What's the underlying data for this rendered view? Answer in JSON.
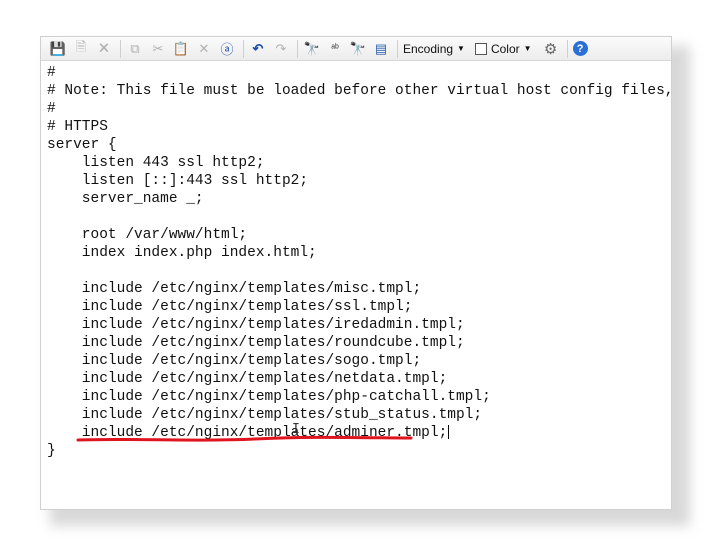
{
  "toolbar": {
    "icons": [
      {
        "name": "save-icon",
        "glyph": "💾",
        "disabled": true
      },
      {
        "name": "save-all-icon",
        "glyph": "🗎",
        "disabled": true
      },
      {
        "name": "close-file-icon",
        "glyph": "🗙",
        "disabled": true
      },
      {
        "name": "copy-icon",
        "glyph": "⧉",
        "disabled": true
      },
      {
        "name": "cut-icon",
        "glyph": "✂",
        "disabled": true
      },
      {
        "name": "paste-icon",
        "glyph": "📋",
        "disabled": false
      },
      {
        "name": "delete-icon",
        "glyph": "✕",
        "disabled": true
      },
      {
        "name": "select-all-icon",
        "glyph": "ⓐ",
        "disabled": false
      },
      {
        "name": "undo-icon",
        "glyph": "↶",
        "disabled": false
      },
      {
        "name": "redo-icon",
        "glyph": "↷",
        "disabled": true
      },
      {
        "name": "find-icon",
        "glyph": "🔭",
        "disabled": false
      },
      {
        "name": "replace-icon",
        "glyph": "ᵃᵇ",
        "disabled": false
      },
      {
        "name": "find-next-icon",
        "glyph": "🔭",
        "disabled": true
      },
      {
        "name": "goto-icon",
        "glyph": "▤",
        "disabled": false
      }
    ],
    "encoding_label": "Encoding",
    "color_label": "Color",
    "help_glyph": "?"
  },
  "editor": {
    "lines": [
      "#",
      "# Note: This file must be loaded before other virtual host config files,",
      "#",
      "# HTTPS",
      "server {",
      "    listen 443 ssl http2;",
      "    listen [::]:443 ssl http2;",
      "    server_name _;",
      "",
      "    root /var/www/html;",
      "    index index.php index.html;",
      "",
      "    include /etc/nginx/templates/misc.tmpl;",
      "    include /etc/nginx/templates/ssl.tmpl;",
      "    include /etc/nginx/templates/iredadmin.tmpl;",
      "    include /etc/nginx/templates/roundcube.tmpl;",
      "    include /etc/nginx/templates/sogo.tmpl;",
      "    include /etc/nginx/templates/netdata.tmpl;",
      "    include /etc/nginx/templates/php-catchall.tmpl;",
      "    include /etc/nginx/templates/stub_status.tmpl;",
      "    include /etc/nginx/templates/adminer.tmpl;",
      "}"
    ],
    "highlight_color": "#e0141e"
  }
}
